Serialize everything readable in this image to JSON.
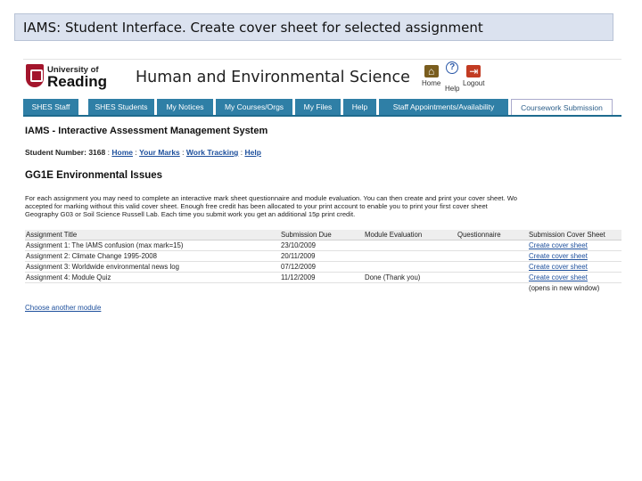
{
  "slide": {
    "title": "IAMS: Student Interface. Create cover sheet for selected assignment"
  },
  "header": {
    "university_of": "University of",
    "university_name": "Reading",
    "site_title": "Human and Environmental Science",
    "icons": [
      {
        "name": "home",
        "label": "Home",
        "glyph": "⌂"
      },
      {
        "name": "help",
        "label": "Help",
        "glyph": "?"
      },
      {
        "name": "logout",
        "label": "Logout",
        "glyph": "⇥"
      }
    ]
  },
  "tabs": [
    {
      "label": "SHES Staff"
    },
    {
      "label": "SHES Students"
    },
    {
      "label": "My Notices"
    },
    {
      "label": "My Courses/Orgs"
    },
    {
      "label": "My Files"
    },
    {
      "label": "Help"
    },
    {
      "label": "Staff Appointments/Availability"
    },
    {
      "label": "Coursework Submission",
      "active": true
    }
  ],
  "system_title": "IAMS - Interactive Assessment Management System",
  "student": {
    "label": "Student Number:",
    "number": "3168",
    "links": [
      "Home",
      "Your Marks",
      "Work Tracking",
      "Help"
    ]
  },
  "module_title": "GG1E Environmental Issues",
  "intro_lines": [
    "For each assignment you may need to complete an interactive mark sheet questionnaire and module evaluation. You can then create and print your cover sheet. Wo",
    "accepted for marking without this valid cover sheet. Enough free credit has been allocated to your print account to enable you to print your first cover sheet",
    "Geography G03 or Soil Science Russell Lab. Each time you submit work you get an additional 15p print credit."
  ],
  "table": {
    "headers": [
      "Assignment Title",
      "Submission Due",
      "Module Evaluation",
      "Questionnaire",
      "Submission Cover Sheet"
    ],
    "rows": [
      {
        "title": "Assignment 1: The IAMS confusion (max mark=15)",
        "due": "23/10/2009",
        "evaluation": "",
        "questionnaire": "",
        "cover": "Create cover sheet"
      },
      {
        "title": "Assignment 2: Climate Change 1995-2008",
        "due": "20/11/2009",
        "evaluation": "",
        "questionnaire": "",
        "cover": "Create cover sheet"
      },
      {
        "title": "Assignment 3: Worldwide environmental news log",
        "due": "07/12/2009",
        "evaluation": "",
        "questionnaire": "",
        "cover": "Create cover sheet"
      },
      {
        "title": "Assignment 4: Module Quiz",
        "due": "11/12/2009",
        "evaluation": "Done (Thank you)",
        "questionnaire": "",
        "cover": "Create cover sheet"
      }
    ],
    "footnote": "(opens in new window)"
  },
  "choose_link": "Choose another module"
}
